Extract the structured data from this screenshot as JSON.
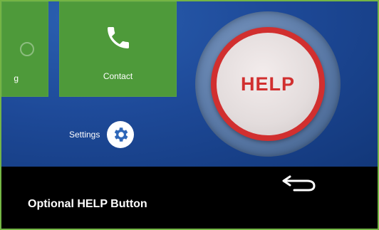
{
  "tiles": {
    "left": {
      "label": "g",
      "icon": "partial-icon"
    },
    "contact": {
      "label": "Contact",
      "icon": "phone-icon"
    }
  },
  "settings": {
    "label": "Settings",
    "icon": "gear-icon"
  },
  "help_button": {
    "label": "HELP"
  },
  "navigation": {
    "back_icon": "back-arrow-icon"
  },
  "caption": "Optional HELP Button",
  "colors": {
    "tile_green": "#4e9a3a",
    "screen_blue": "#1e4a99",
    "help_red": "#d12f2f",
    "frame_border": "#74b545"
  }
}
